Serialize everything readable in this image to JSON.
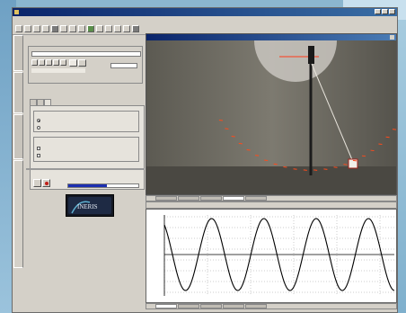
{
  "window": {
    "title": ""
  },
  "menu": {
    "items": [
      "",
      "",
      "",
      "",
      "",
      ""
    ]
  },
  "video": {
    "title": ""
  },
  "panel": {
    "tabs": [
      "",
      "",
      ""
    ],
    "shot_group_label": "",
    "path_field": "",
    "image_info": "",
    "treatment_label": "",
    "progress_label": "",
    "progress": 0.55
  },
  "plot": {
    "tabs": [
      "",
      "",
      "",
      "",
      ""
    ],
    "y_ticks": [],
    "x_ticks": []
  },
  "logo": {
    "text": "INERIS"
  },
  "colors": {
    "title_bar": "#0a246a",
    "trace_orange": "#ff4a1a",
    "progress_fill": "#1c2fb0"
  }
}
